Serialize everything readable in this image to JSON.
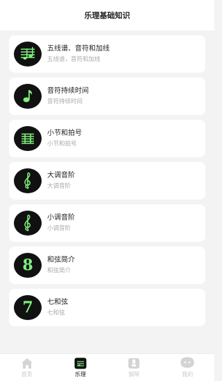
{
  "header": {
    "title": "乐理基础知识"
  },
  "lessons": [
    {
      "title": "五线谱、音符和加线",
      "subtitle": "五线谱，音符和加线",
      "icon": "staff-notes-icon"
    },
    {
      "title": "音符持续时间",
      "subtitle": "音符持续时间",
      "icon": "music-note-icon"
    },
    {
      "title": "小节和拍号",
      "subtitle": "小节和拍号",
      "icon": "staff-lines-icon"
    },
    {
      "title": "大调音阶",
      "subtitle": "大调音阶",
      "icon": "treble-clef-icon"
    },
    {
      "title": "小调音阶",
      "subtitle": "小调音阶",
      "icon": "treble-clef-icon"
    },
    {
      "title": "和弦简介",
      "subtitle": "和弦简介",
      "icon": "chord-eight-icon",
      "glyph": "8"
    },
    {
      "title": "七和弦",
      "subtitle": "七和弦",
      "icon": "chord-seven-icon",
      "glyph": "7"
    }
  ],
  "tabbar": {
    "items": [
      {
        "label": "首页",
        "icon": "home-icon",
        "active": false
      },
      {
        "label": "乐理",
        "icon": "music-theory-icon",
        "active": true
      },
      {
        "label": "钢琴",
        "icon": "piano-icon",
        "active": false
      },
      {
        "label": "我的",
        "icon": "profile-icon",
        "active": false
      }
    ]
  },
  "colors": {
    "accent": "#7ef27a",
    "icon_bg": "#111111",
    "background": "#f3f3f3"
  }
}
